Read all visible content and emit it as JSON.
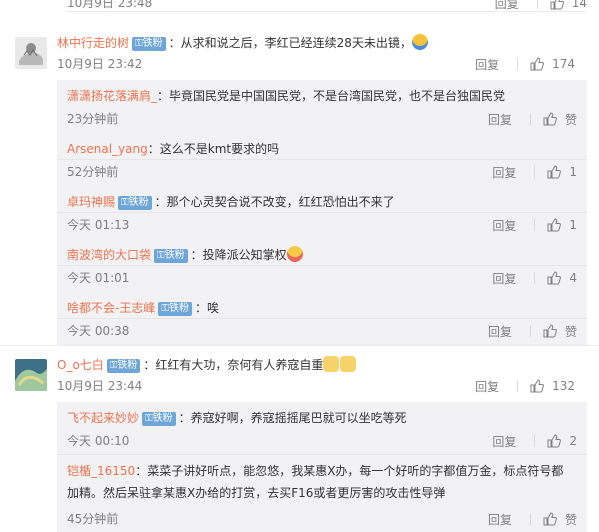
{
  "top": {
    "time": "10月9日 23:48",
    "reply": "回复",
    "likes": "14"
  },
  "comments": [
    {
      "user": "林中行走的树",
      "badge": "铁粉",
      "text": "：从求和说之后，李红已经连续28天未出镜，",
      "time": "10月9日 23:42",
      "reply": "回复",
      "likes": "174",
      "replies": [
        {
          "user": "潇潇扬花落满肩_",
          "text": "：毕竟国民党是中国国民党，不是台湾国民党，也不是台独国民党",
          "time": "23分钟前",
          "reply": "回复",
          "likes": "赞"
        },
        {
          "user": "Arsenal_yang",
          "text": "：这么不是kmt要求的吗",
          "time": "52分钟前",
          "reply": "回复",
          "likes": "1"
        },
        {
          "user": "卓玛神赐",
          "badge": "铁粉",
          "text": "：那个心灵契合说不改变，红红恐怕出不来了",
          "time": "今天 01:13",
          "reply": "回复",
          "likes": "1"
        },
        {
          "user": "南波湾的大口袋",
          "badge": "铁粉",
          "text": "：投降派公知掌权",
          "time": "今天 01:01",
          "reply": "回复",
          "likes": "4"
        },
        {
          "user": "啥都不会-王志峰",
          "badge": "铁粉",
          "text": "：唉",
          "time": "今天 00:38",
          "reply": "回复",
          "likes": "赞"
        }
      ]
    },
    {
      "user": "O_o七白",
      "badge": "铁粉",
      "text": "：红红有大功，奈何有人养寇自重",
      "time": "10月9日 23:44",
      "reply": "回复",
      "likes": "132",
      "replies": [
        {
          "user": "飞不起来妙妙",
          "badge": "铁粉",
          "text": "：养寇好啊，养寇摇摇尾巴就可以坐吃等死",
          "time": "今天 00:10",
          "reply": "回复",
          "likes": "2"
        },
        {
          "user": "铠楯_16150",
          "text": "：菜菜子讲好听点，能忽悠，我某惠X办，每一个好听的字都值万金，标点符号都",
          "text2": "加精。然后呆驻拿某惠X办给的打赏，去买F16或者更厉害的攻击性导弹",
          "time": "45分钟前",
          "reply": "回复",
          "likes": "赞"
        }
      ]
    }
  ],
  "colors": {
    "username": "#eb7350",
    "main_username": "#eb7350",
    "badge_bg": "#6fa6d8",
    "meta": "#808080",
    "sub_bg": "#f2f2f5"
  },
  "icons": {
    "like": "thumbs-up-icon",
    "badge": "fan-badge-icon"
  }
}
